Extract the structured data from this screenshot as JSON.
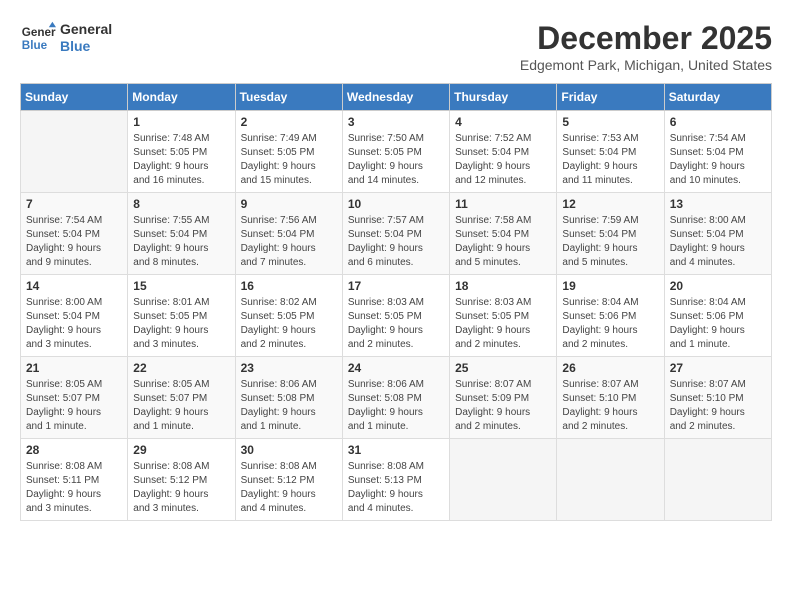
{
  "header": {
    "logo_line1": "General",
    "logo_line2": "Blue",
    "month": "December 2025",
    "location": "Edgemont Park, Michigan, United States"
  },
  "days_of_week": [
    "Sunday",
    "Monday",
    "Tuesday",
    "Wednesday",
    "Thursday",
    "Friday",
    "Saturday"
  ],
  "weeks": [
    [
      {
        "day": "",
        "info": ""
      },
      {
        "day": "1",
        "info": "Sunrise: 7:48 AM\nSunset: 5:05 PM\nDaylight: 9 hours\nand 16 minutes."
      },
      {
        "day": "2",
        "info": "Sunrise: 7:49 AM\nSunset: 5:05 PM\nDaylight: 9 hours\nand 15 minutes."
      },
      {
        "day": "3",
        "info": "Sunrise: 7:50 AM\nSunset: 5:05 PM\nDaylight: 9 hours\nand 14 minutes."
      },
      {
        "day": "4",
        "info": "Sunrise: 7:52 AM\nSunset: 5:04 PM\nDaylight: 9 hours\nand 12 minutes."
      },
      {
        "day": "5",
        "info": "Sunrise: 7:53 AM\nSunset: 5:04 PM\nDaylight: 9 hours\nand 11 minutes."
      },
      {
        "day": "6",
        "info": "Sunrise: 7:54 AM\nSunset: 5:04 PM\nDaylight: 9 hours\nand 10 minutes."
      }
    ],
    [
      {
        "day": "7",
        "info": "Sunrise: 7:54 AM\nSunset: 5:04 PM\nDaylight: 9 hours\nand 9 minutes."
      },
      {
        "day": "8",
        "info": "Sunrise: 7:55 AM\nSunset: 5:04 PM\nDaylight: 9 hours\nand 8 minutes."
      },
      {
        "day": "9",
        "info": "Sunrise: 7:56 AM\nSunset: 5:04 PM\nDaylight: 9 hours\nand 7 minutes."
      },
      {
        "day": "10",
        "info": "Sunrise: 7:57 AM\nSunset: 5:04 PM\nDaylight: 9 hours\nand 6 minutes."
      },
      {
        "day": "11",
        "info": "Sunrise: 7:58 AM\nSunset: 5:04 PM\nDaylight: 9 hours\nand 5 minutes."
      },
      {
        "day": "12",
        "info": "Sunrise: 7:59 AM\nSunset: 5:04 PM\nDaylight: 9 hours\nand 5 minutes."
      },
      {
        "day": "13",
        "info": "Sunrise: 8:00 AM\nSunset: 5:04 PM\nDaylight: 9 hours\nand 4 minutes."
      }
    ],
    [
      {
        "day": "14",
        "info": "Sunrise: 8:00 AM\nSunset: 5:04 PM\nDaylight: 9 hours\nand 3 minutes."
      },
      {
        "day": "15",
        "info": "Sunrise: 8:01 AM\nSunset: 5:05 PM\nDaylight: 9 hours\nand 3 minutes."
      },
      {
        "day": "16",
        "info": "Sunrise: 8:02 AM\nSunset: 5:05 PM\nDaylight: 9 hours\nand 2 minutes."
      },
      {
        "day": "17",
        "info": "Sunrise: 8:03 AM\nSunset: 5:05 PM\nDaylight: 9 hours\nand 2 minutes."
      },
      {
        "day": "18",
        "info": "Sunrise: 8:03 AM\nSunset: 5:05 PM\nDaylight: 9 hours\nand 2 minutes."
      },
      {
        "day": "19",
        "info": "Sunrise: 8:04 AM\nSunset: 5:06 PM\nDaylight: 9 hours\nand 2 minutes."
      },
      {
        "day": "20",
        "info": "Sunrise: 8:04 AM\nSunset: 5:06 PM\nDaylight: 9 hours\nand 1 minute."
      }
    ],
    [
      {
        "day": "21",
        "info": "Sunrise: 8:05 AM\nSunset: 5:07 PM\nDaylight: 9 hours\nand 1 minute."
      },
      {
        "day": "22",
        "info": "Sunrise: 8:05 AM\nSunset: 5:07 PM\nDaylight: 9 hours\nand 1 minute."
      },
      {
        "day": "23",
        "info": "Sunrise: 8:06 AM\nSunset: 5:08 PM\nDaylight: 9 hours\nand 1 minute."
      },
      {
        "day": "24",
        "info": "Sunrise: 8:06 AM\nSunset: 5:08 PM\nDaylight: 9 hours\nand 1 minute."
      },
      {
        "day": "25",
        "info": "Sunrise: 8:07 AM\nSunset: 5:09 PM\nDaylight: 9 hours\nand 2 minutes."
      },
      {
        "day": "26",
        "info": "Sunrise: 8:07 AM\nSunset: 5:10 PM\nDaylight: 9 hours\nand 2 minutes."
      },
      {
        "day": "27",
        "info": "Sunrise: 8:07 AM\nSunset: 5:10 PM\nDaylight: 9 hours\nand 2 minutes."
      }
    ],
    [
      {
        "day": "28",
        "info": "Sunrise: 8:08 AM\nSunset: 5:11 PM\nDaylight: 9 hours\nand 3 minutes."
      },
      {
        "day": "29",
        "info": "Sunrise: 8:08 AM\nSunset: 5:12 PM\nDaylight: 9 hours\nand 3 minutes."
      },
      {
        "day": "30",
        "info": "Sunrise: 8:08 AM\nSunset: 5:12 PM\nDaylight: 9 hours\nand 4 minutes."
      },
      {
        "day": "31",
        "info": "Sunrise: 8:08 AM\nSunset: 5:13 PM\nDaylight: 9 hours\nand 4 minutes."
      },
      {
        "day": "",
        "info": ""
      },
      {
        "day": "",
        "info": ""
      },
      {
        "day": "",
        "info": ""
      }
    ]
  ]
}
